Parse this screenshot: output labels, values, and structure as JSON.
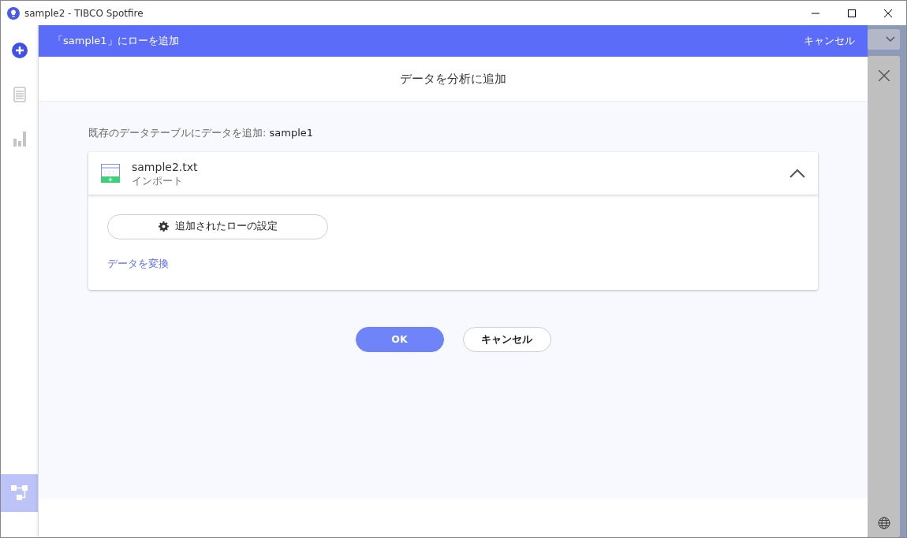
{
  "window": {
    "title": "sample2 - TIBCO Spotfire"
  },
  "sidebar": {
    "items": [
      {
        "kind": "add",
        "selected": false
      },
      {
        "kind": "table",
        "selected": false
      },
      {
        "kind": "chart",
        "selected": false
      },
      {
        "kind": "flow",
        "selected": true
      }
    ]
  },
  "dialog": {
    "title": "「sample1」にローを追加",
    "cancel_link": "キャンセル",
    "heading": "データを分析に追加",
    "target_label": "既存のデータテーブルにデータを追加:",
    "target_name": "sample1",
    "source": {
      "name": "sample2.txt",
      "subtitle": "インポート",
      "expanded": true
    },
    "settings_button": "追加されたローの設定",
    "transform_link": "データを変換",
    "buttons": [
      {
        "kind": "primary",
        "label": "OK"
      },
      {
        "kind": "secondary",
        "label": "キャンセル"
      }
    ]
  }
}
